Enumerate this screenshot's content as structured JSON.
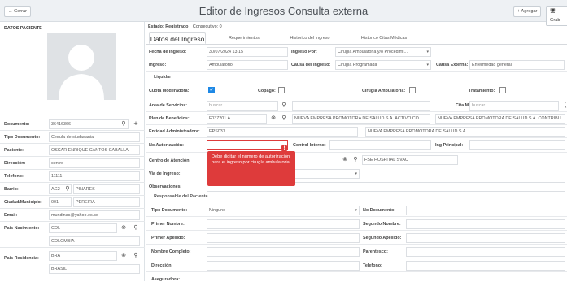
{
  "topbar": {
    "back_label": "← Cerrar",
    "title": "Editor de Ingresos Consulta externa",
    "add_label": "+ Agregar",
    "save_label": "🖥 Grab"
  },
  "patient": {
    "section_title": "DATOS PACIENTE",
    "documento_label": "Documento:",
    "documento": "36416366",
    "tipo_documento_label": "Tipo Documento:",
    "tipo_documento": "Cedula de ciudadania",
    "paciente_label": "Paciente:",
    "paciente": "OSCAR ENRIQUE CANTOS CABALLA",
    "direccion_label": "Dirección:",
    "direccion": "centro",
    "telefono_label": "Telefono:",
    "telefono": "11111",
    "barrio_label": "Barrio:",
    "barrio_code": "AG2",
    "barrio": "PINARES",
    "ciudad_label": "Ciudad/Municipio:",
    "ciudad_code": "001",
    "ciudad": "PEREIRA",
    "email_label": "Email:",
    "email": "mundinas@yahoo.es.co",
    "pais_nac_label": "Pais Nacimiento:",
    "pais_nac_code": "COL",
    "pais_nac": "COLOMBIA",
    "pais_res_label": "Pais Residencia:",
    "pais_res_code": "BRA",
    "pais_res": "BRASIL"
  },
  "status": {
    "label": "Estado: Registrado",
    "consecutivo": "Consecutivo: 0"
  },
  "tabs": [
    "Datos del Ingreso",
    "Requerimientos",
    "Historico del Ingreso",
    "Historico Citas Médicas"
  ],
  "ingreso": {
    "fecha_label": "Fecha de Ingreso:",
    "fecha": "30/07/2024 13:15",
    "ingreso_por_label": "Ingreso Por:",
    "ingreso_por": "Cirugía Ambulatoria y/o Procedimi...",
    "ingreso_label": "Ingreso:",
    "ingreso": "Ambulatorio",
    "causa_label": "Causa del Ingreso:",
    "causa": "Cirugía Programada",
    "causa_ext_label": "Causa Externa:",
    "causa_ext": "Enfermedad general",
    "liquidar_label": "Liquidar",
    "cuota_label": "Cuota Moderadora:",
    "copago_label": "Copago:",
    "cirugia_amb_label": "Cirugía Ambulatoria:",
    "tratamiento_label": "Tratamiento:",
    "area_label": "Area de Servicios:",
    "area_ph": "buscar...",
    "cita_label": "Cita Médica:",
    "cita_ph": "buscar...",
    "plan_label": "Plan de Beneficios:",
    "plan_code": "F037201 A",
    "plan_name": "NUEVA EMPRESA PROMOTORA DE SALUD S.A. ACTIVO CO",
    "plan_name2": "NUEVA EMPRESA PROMOTORA DE SALUD S.A. CONTRIBU",
    "entidad_label": "Entidad Administradora:",
    "entidad_code": "EPS037",
    "entidad_name": "NUEVA EMPRESA PROMOTORA DE SALUD S.A.",
    "autorizacion_label": "No Autorización:",
    "control_label": "Control Interno:",
    "principal_label": "Ing Principal:",
    "tooltip": "Debe digitar el número de autorización para el ingreso por cirugía ambulatoria",
    "centro_label": "Centro de Atención:",
    "centro": "FSE HOSPITAL SVAC",
    "via_label": "Via de Ingreso:",
    "observaciones_label": "Observaciones:"
  },
  "responsable": {
    "title": "Responsable del Paciente",
    "tipo_doc_label": "Tipo Documento:",
    "tipo_doc": "Ninguno",
    "no_doc_label": "No Documento:",
    "primer_nombre_label": "Primer Nombre:",
    "segundo_nombre_label": "Segundo Nombre:",
    "primer_apellido_label": "Primer Apellido:",
    "segundo_apellido_label": "Segundo Apellido:",
    "nombre_completo_label": "Nombre Completo:",
    "parentesco_label": "Parentesco:",
    "direccion_label": "Dirección:",
    "telefono_label": "Telefono:",
    "aseguradora_label": "Aseguradora:"
  },
  "colors": {
    "accent": "#1e88e5",
    "error": "#de3b3b"
  }
}
